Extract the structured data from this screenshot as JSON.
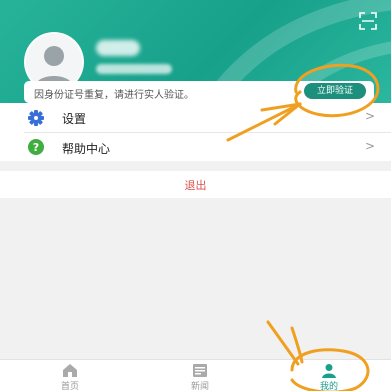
{
  "header": {
    "scan_icon": "scan-icon",
    "avatar_icon": "default-avatar-icon"
  },
  "notice": {
    "text": "因身份证号重复，请进行实人验证。",
    "button_label": "立即验证"
  },
  "menu": {
    "items": [
      {
        "label": "设置",
        "icon": "gear-icon",
        "chevron": ">"
      },
      {
        "label": "帮助中心",
        "icon": "question-icon",
        "chevron": ">"
      }
    ]
  },
  "logout": {
    "label": "退出"
  },
  "tabbar": {
    "tabs": [
      {
        "label": "首页",
        "icon": "home-icon",
        "active": false
      },
      {
        "label": "新闻",
        "icon": "news-icon",
        "active": false
      },
      {
        "label": "我的",
        "icon": "user-icon",
        "active": true
      }
    ]
  },
  "colors": {
    "brand": "#1aa08a",
    "logout": "#d9534f",
    "annotation": "#f0a020"
  }
}
